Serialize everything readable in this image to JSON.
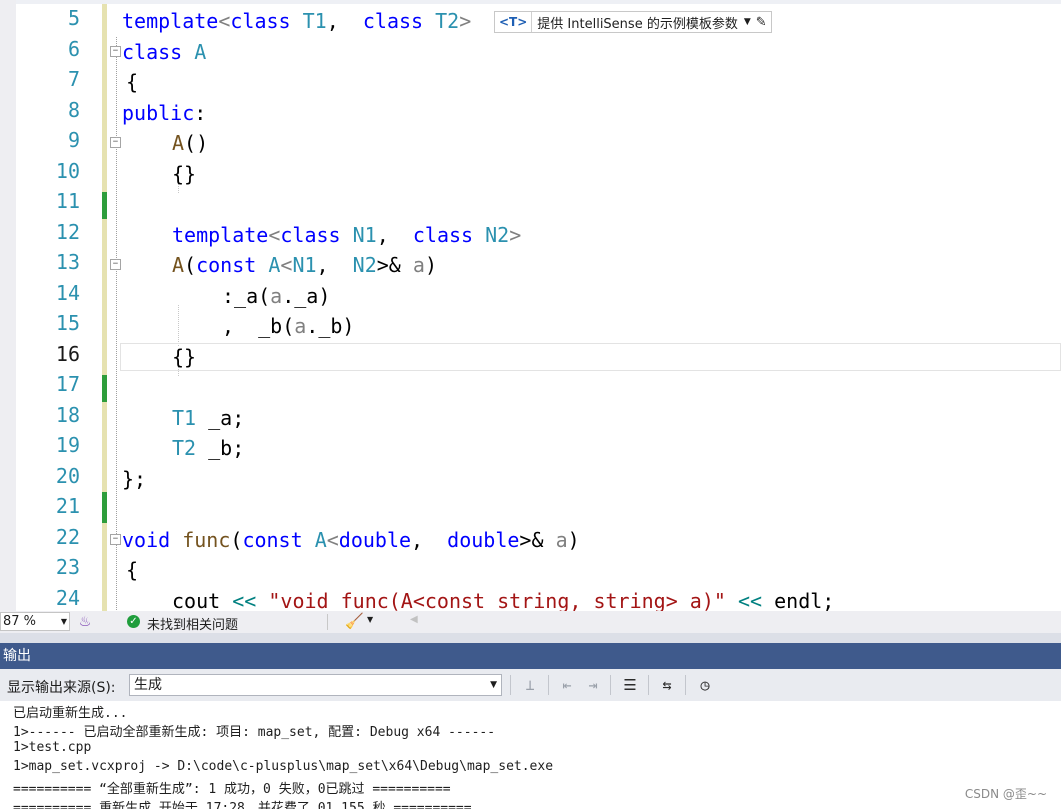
{
  "editor": {
    "line_numbers": [
      "5",
      "6",
      "7",
      "8",
      "9",
      "10",
      "11",
      "12",
      "13",
      "14",
      "15",
      "16",
      "17",
      "18",
      "19",
      "20",
      "21",
      "22",
      "23",
      "24"
    ],
    "current_line": "16",
    "hint": {
      "badge": "<T>",
      "label": "提供 IntelliSense 的示例模板参数"
    },
    "code": {
      "l5": [
        "template",
        "<",
        "class",
        " ",
        "T1",
        ",  ",
        "class",
        " ",
        "T2",
        ">"
      ],
      "l6": [
        "class",
        " ",
        "A"
      ],
      "l7": [
        "{"
      ],
      "l8": [
        "public",
        ":"
      ],
      "l9": [
        "A",
        "()"
      ],
      "l10": [
        "{}"
      ],
      "l12": [
        "template",
        "<",
        "class",
        " ",
        "N1",
        ",  ",
        "class",
        " ",
        "N2",
        ">"
      ],
      "l13": [
        "A",
        "(",
        "const",
        " ",
        "A",
        "<",
        "N1",
        ",  ",
        "N2",
        ">&",
        " ",
        "a",
        ")"
      ],
      "l14": [
        ":_a(",
        "a",
        "._a)"
      ],
      "l15": [
        ",  _b(",
        "a",
        "._b)"
      ],
      "l16": [
        "{}"
      ],
      "l18": [
        "T1",
        " _a;"
      ],
      "l19": [
        "T2",
        " _b;"
      ],
      "l20": [
        "};"
      ],
      "l22": [
        "void",
        " ",
        "func",
        "(",
        "const",
        " ",
        "A",
        "<",
        "double",
        ",  ",
        "double",
        ">&",
        " ",
        "a",
        ")"
      ],
      "l23": [
        "{"
      ],
      "l24": [
        "cout",
        " ",
        "<<",
        " ",
        "\"void func(A<const string, string> a)\"",
        " ",
        "<<",
        " ",
        "endl",
        ";"
      ]
    }
  },
  "editor_status": {
    "zoom": "87 %",
    "issues": "未找到相关问题"
  },
  "output": {
    "title": "输出",
    "source_label": "显示输出来源(S):",
    "source_value": "生成",
    "lines": [
      "已启动重新生成...",
      "1>------ 已启动全部重新生成: 项目: map_set, 配置: Debug x64 ------",
      "1>test.cpp",
      "1>map_set.vcxproj -> D:\\code\\c-plusplus\\map_set\\x64\\Debug\\map_set.exe",
      "========== “全部重新生成”: 1 成功，0 失败，0已跳过 ==========",
      "========== 重新生成 开始于 17:28，并花费了 01.155 秒 =========="
    ]
  },
  "watermark": "CSDN @歪~~",
  "colors": {
    "keyword": "#0000ff",
    "type": "#2b91af",
    "function": "#74531f",
    "param": "#808080",
    "string": "#a31515",
    "header": "#3f5a8c"
  }
}
